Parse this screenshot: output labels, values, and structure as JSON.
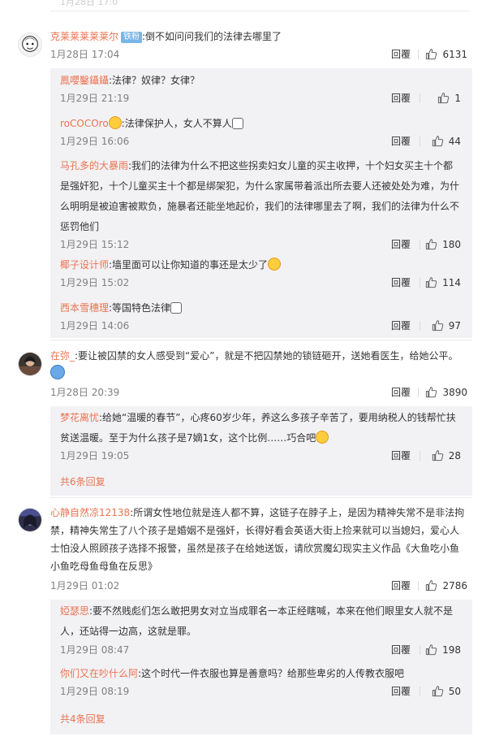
{
  "top_cut": {
    "label": "1月28日 17:0"
  },
  "common": {
    "reply_label": "回覆"
  },
  "comments": [
    {
      "user": "克莱莱莱莱莱尔",
      "badge": "铁粉",
      "text": ":倒不如问问我们的法律去哪里了",
      "time": "1月28日 17:04",
      "likes": "6131",
      "subs": [
        {
          "user": "鳳嚶鑿鑷鑷",
          "text": ":法律？奴律？女律？",
          "time": "1月29日 21:19",
          "likes": "1"
        },
        {
          "user": "roCOCOro",
          "text": ":法律保护人，女人不算人",
          "time": "1月29日 16:06",
          "likes": "44"
        },
        {
          "user": "马孔多的大暴雨",
          "text": ":我们的法律为什么不把这些拐卖妇女儿童的买主收押，十个妇女买主十个都是强奸犯，十个儿童买主十个都是绑架犯，为什么家属带着派出所去要人还被处处为难，为什么明明是被迫害被欺负，施暴者还能坐地起价，我们的法律哪里去了啊，我们的法律为什么不惩罚他们",
          "time": "1月29日 15:12",
          "likes": "180"
        },
        {
          "user": "椰子设计师",
          "text": ":墙里面可以让你知道的事还是太少了",
          "time": "1月29日 15:02",
          "likes": "114"
        },
        {
          "user": "西本雪穗理",
          "text": ":等国特色法律",
          "time": "1月29日 14:06",
          "likes": "97"
        }
      ]
    },
    {
      "user": "在弥_",
      "text": ":要让被囚禁的女人感受到“爱心”，就是不把囚禁她的锁链砸开，送她看医生，给她公平。",
      "time": "1月28日 20:39",
      "likes": "3890",
      "subs": [
        {
          "user": "梦花离忧",
          "text": ":给她“温暖的春节”，心疼60岁少年，养这么多孩子辛苦了，要用纳税人的钱帮忙扶贫送温暖。至于为什么孩子是7嫡1女，这个比例……巧合吧",
          "time": "1月29日 19:05",
          "likes": "28"
        }
      ],
      "more": "共6条回复"
    },
    {
      "user": "心静自然凉12138",
      "text": ":所谓女性地位就是连人都不算，这链子在脖子上，是因为精神失常不是非法拘禁，精神失常生了八个孩子是婚姻不是强奸，长得好看会英语大街上捡来就可以当媳妇，爱心人士怕没人照顾孩子选择不报警，虽然是孩子在给她送饭，请欣赏魔幻现实主义作品《大鱼吃小鱼小鱼吃母鱼母鱼在反思》",
      "time": "1月29日 01:02",
      "likes": "2786",
      "subs": [
        {
          "user": "婭瑟思",
          "text": ":要不然贱彪们怎么敢把男女对立当成罪名一本正经瞎喊，本来在他们眼里女人就不是人，还站得一边高，这就是罪。",
          "time": "1月29日 08:47",
          "likes": "198"
        },
        {
          "user": "你们又在吵什么阿",
          "text": ":这个时代一件衣服也算是善意吗？给那些卑劣的人传教衣服吧",
          "time": "1月29日 08:19",
          "likes": "50"
        }
      ],
      "more": "共4条回复"
    }
  ],
  "colors": {
    "username": "#eb7350",
    "subbox_bg": "#f2f2f5",
    "badge_bg": "#78b5e8",
    "meta_text": "#808080"
  },
  "icons": [
    "thumbs-up-icon",
    "avatar"
  ]
}
